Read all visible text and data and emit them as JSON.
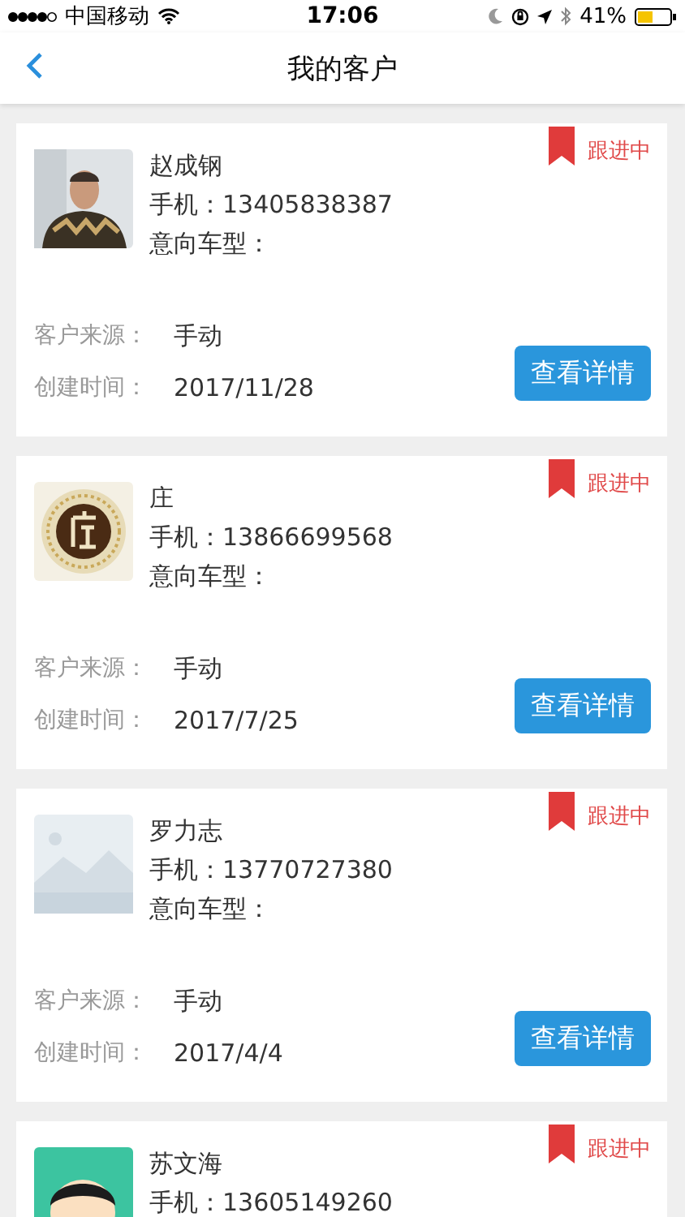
{
  "status_bar": {
    "carrier": "中国移动",
    "time": "17:06",
    "battery": "41%"
  },
  "nav": {
    "title": "我的客户"
  },
  "customers": [
    {
      "name": "赵成钢",
      "phone": "手机：13405838387",
      "car_label": "意向车型：",
      "source_label": "客户来源：",
      "source": "手动",
      "created_label": "创建时间：",
      "created": "2017/11/28",
      "status": "跟进中",
      "button": "查看详情"
    },
    {
      "name": "庄",
      "phone": "手机：13866699568",
      "car_label": "意向车型：",
      "source_label": "客户来源：",
      "source": "手动",
      "created_label": "创建时间：",
      "created": "2017/7/25",
      "status": "跟进中",
      "button": "查看详情",
      "avatar": {
        "kind": "logo"
      }
    },
    {
      "name": "罗力志",
      "phone": "手机：13770727380",
      "car_label": "意向车型：",
      "source_label": "客户来源：",
      "source": "手动",
      "created_label": "创建时间：",
      "created": "2017/4/4",
      "status": "跟进中",
      "button": "查看详情",
      "avatar": {
        "kind": "placeholder"
      }
    },
    {
      "name": "苏文海",
      "phone": "手机：13605149260",
      "status": "跟进中",
      "avatar": {
        "kind": "cartoon"
      }
    }
  ]
}
